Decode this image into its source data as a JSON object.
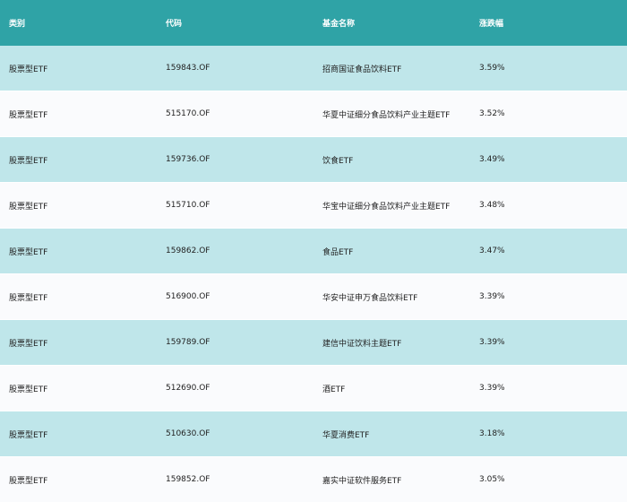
{
  "columns": [
    "类别",
    "代码",
    "基金名称",
    "涨跌幅"
  ],
  "rows": [
    [
      "股票型ETF",
      "159843.OF",
      "招商国证食品饮料ETF",
      "3.59%"
    ],
    [
      "股票型ETF",
      "515170.OF",
      "华夏中证细分食品饮料产业主题ETF",
      "3.52%"
    ],
    [
      "股票型ETF",
      "159736.OF",
      "饮食ETF",
      "3.49%"
    ],
    [
      "股票型ETF",
      "515710.OF",
      "华宝中证细分食品饮料产业主题ETF",
      "3.48%"
    ],
    [
      "股票型ETF",
      "159862.OF",
      "食品ETF",
      "3.47%"
    ],
    [
      "股票型ETF",
      "516900.OF",
      "华安中证申万食品饮料ETF",
      "3.39%"
    ],
    [
      "股票型ETF",
      "159789.OF",
      "建信中证饮料主题ETF",
      "3.39%"
    ],
    [
      "股票型ETF",
      "512690.OF",
      "酒ETF",
      "3.39%"
    ],
    [
      "股票型ETF",
      "510630.OF",
      "华夏消费ETF",
      "3.18%"
    ],
    [
      "股票型ETF",
      "159852.OF",
      "嘉实中证软件服务ETF",
      "3.05%"
    ]
  ],
  "colors": {
    "header_bg": "#2fa3a6",
    "row_odd_bg": "#bfe6ea",
    "row_even_bg": "#fafbfd"
  }
}
